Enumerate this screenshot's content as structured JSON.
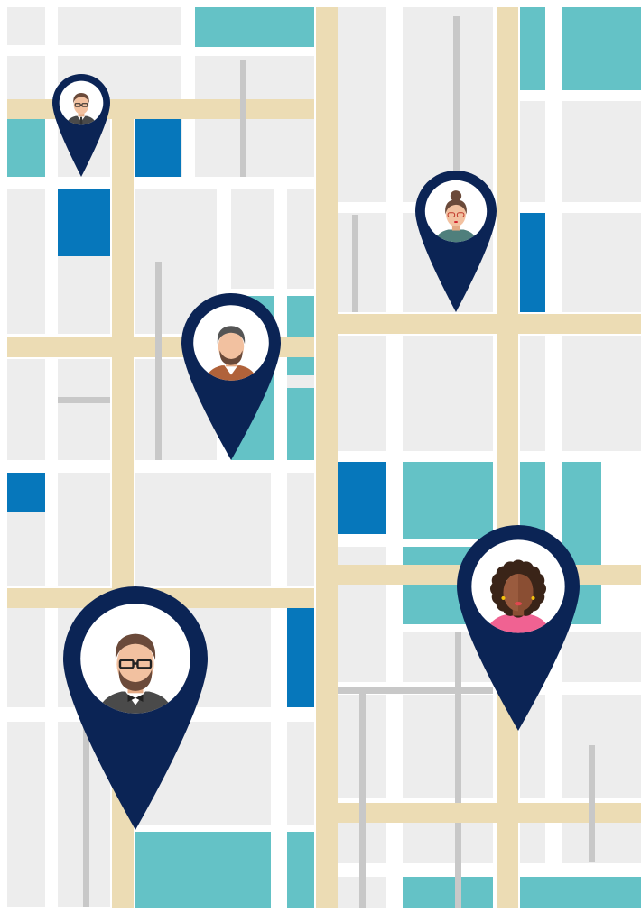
{
  "colors": {
    "background": "#ffffff",
    "block": "#ededed",
    "street": "#ffffff",
    "main_road": "#ecdcb4",
    "alley": "#c8c8c8",
    "teal_block": "#64c2c6",
    "blue_block": "#0677bb",
    "pin": "#0b2455"
  },
  "markers": [
    {
      "name": "man-glasses-suit-avatar",
      "avatar": "man_suit"
    },
    {
      "name": "woman-bun-glasses-avatar",
      "avatar": "woman_bun"
    },
    {
      "name": "man-beard-avatar",
      "avatar": "man_beard"
    },
    {
      "name": "man-glasses-bowtie-avatar",
      "avatar": "man_bowtie"
    },
    {
      "name": "woman-curly-hair-avatar",
      "avatar": "woman_curly"
    }
  ]
}
